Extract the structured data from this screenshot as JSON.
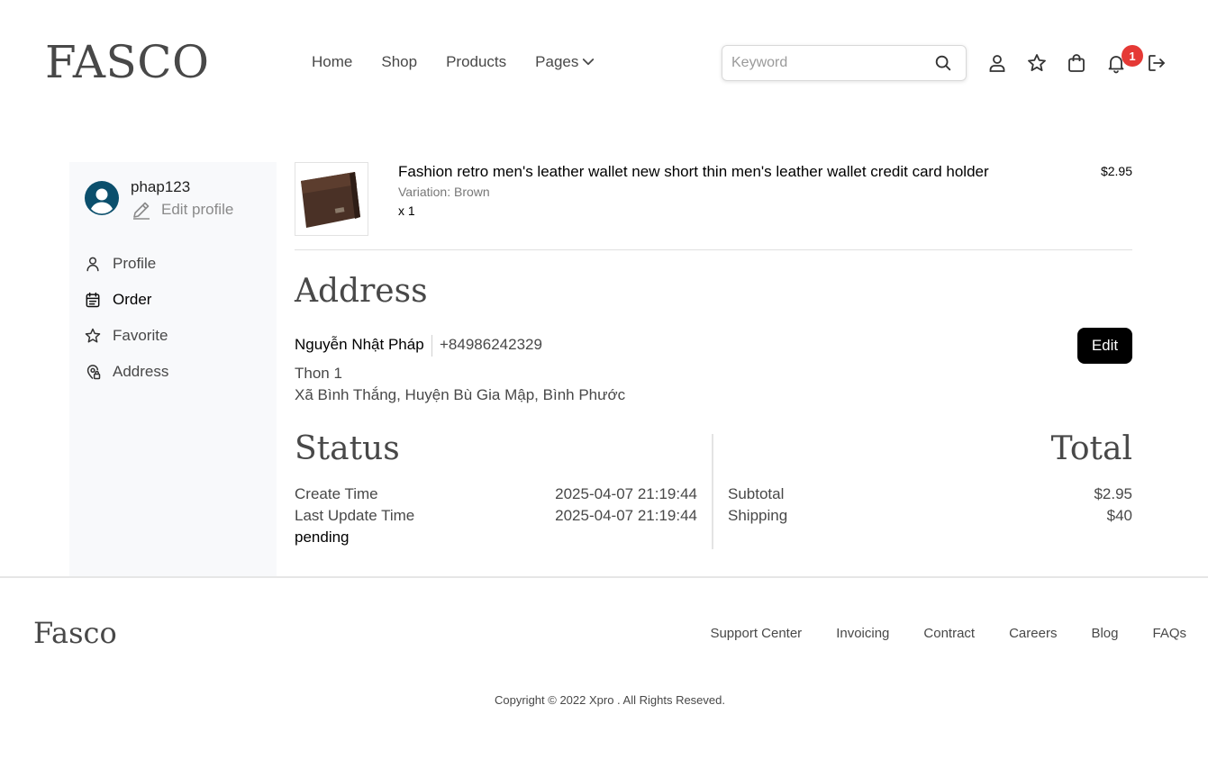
{
  "header": {
    "logo": "FASCO",
    "nav": [
      {
        "label": "Home"
      },
      {
        "label": "Shop"
      },
      {
        "label": "Products"
      },
      {
        "label": "Pages"
      }
    ],
    "search": {
      "placeholder": "Keyword",
      "value": ""
    },
    "notification_count": "1"
  },
  "sidebar": {
    "username": "phap123",
    "edit_profile": "Edit profile",
    "items": [
      {
        "label": "Profile",
        "icon": "user-icon"
      },
      {
        "label": "Order",
        "icon": "calendar-icon",
        "active": true
      },
      {
        "label": "Favorite",
        "icon": "star-icon"
      },
      {
        "label": "Address",
        "icon": "map-pin-icon"
      }
    ]
  },
  "order": {
    "product": {
      "name": "Fashion retro men's leather wallet new short thin men's leather wallet credit card holder",
      "variation": "Variation: Brown",
      "quantity": "x 1",
      "price": "$2.95"
    },
    "address": {
      "heading": "Address",
      "name": "Nguyễn Nhật Pháp",
      "phone": "+84986242329",
      "line1": "Thon 1",
      "line2": "Xã Bình Thắng, Huyện Bù Gia Mập, Bình Phước",
      "edit_label": "Edit"
    },
    "status": {
      "heading": "Status",
      "create_label": "Create Time",
      "create_value": "2025-04-07 21:19:44",
      "update_label": "Last Update Time",
      "update_value": "2025-04-07 21:19:44",
      "state": "pending"
    },
    "total": {
      "heading": "Total",
      "subtotal_label": "Subtotal",
      "subtotal_value": "$2.95",
      "shipping_label": "Shipping",
      "shipping_value": "$40"
    }
  },
  "footer": {
    "logo": "Fasco",
    "links": [
      "Support Center",
      "Invoicing",
      "Contract",
      "Careers",
      "Blog",
      "FAQs"
    ],
    "copyright": "Copyright © 2022 Xpro . All Rights Reseved."
  },
  "colors": {
    "text": "#484848",
    "sidebar_bg": "#f8f9fb",
    "avatar": "#0b4f6c",
    "badge": "#e53935",
    "button": "#000000"
  }
}
